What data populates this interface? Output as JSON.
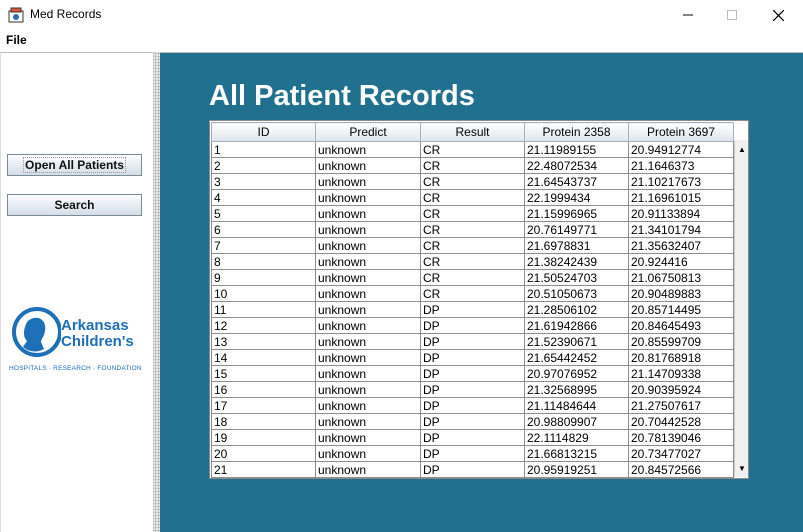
{
  "window": {
    "title": "Med Records",
    "controls": {
      "minimize": "—",
      "maximize": "☐",
      "close": "✕"
    }
  },
  "menu": {
    "file": "File"
  },
  "sidebar": {
    "open_all_label": "Open All Patients",
    "search_label": "Search",
    "logo": {
      "line1": "Arkansas",
      "line2": "Children's",
      "tagline": "HOSPITALS · RESEARCH · FOUNDATION"
    }
  },
  "main": {
    "title": "All Patient Records",
    "table": {
      "columns": [
        "ID",
        "Predict",
        "Result",
        "Protein 2358",
        "Protein 3697"
      ],
      "rows": [
        [
          "1",
          "unknown",
          "CR",
          "21.11989155",
          "20.94912774"
        ],
        [
          "2",
          "unknown",
          "CR",
          "22.48072534",
          "21.1646373"
        ],
        [
          "3",
          "unknown",
          "CR",
          "21.64543737",
          "21.10217673"
        ],
        [
          "4",
          "unknown",
          "CR",
          "22.1999434",
          "21.16961015"
        ],
        [
          "5",
          "unknown",
          "CR",
          "21.15996965",
          "20.91133894"
        ],
        [
          "6",
          "unknown",
          "CR",
          "20.76149771",
          "21.34101794"
        ],
        [
          "7",
          "unknown",
          "CR",
          "21.6978831",
          "21.35632407"
        ],
        [
          "8",
          "unknown",
          "CR",
          "21.38242439",
          "20.924416"
        ],
        [
          "9",
          "unknown",
          "CR",
          "21.50524703",
          "21.06750813"
        ],
        [
          "10",
          "unknown",
          "CR",
          "20.51050673",
          "20.90489883"
        ],
        [
          "11",
          "unknown",
          "DP",
          "21.28506102",
          "20.85714495"
        ],
        [
          "12",
          "unknown",
          "DP",
          "21.61942866",
          "20.84645493"
        ],
        [
          "13",
          "unknown",
          "DP",
          "21.52390671",
          "20.85599709"
        ],
        [
          "14",
          "unknown",
          "DP",
          "21.65442452",
          "20.81768918"
        ],
        [
          "15",
          "unknown",
          "DP",
          "20.97076952",
          "21.14709338"
        ],
        [
          "16",
          "unknown",
          "DP",
          "21.32568995",
          "20.90395924"
        ],
        [
          "17",
          "unknown",
          "DP",
          "21.11484644",
          "21.27507617"
        ],
        [
          "18",
          "unknown",
          "DP",
          "20.98809907",
          "20.70442528"
        ],
        [
          "19",
          "unknown",
          "DP",
          "22.1114829",
          "20.78139046"
        ],
        [
          "20",
          "unknown",
          "DP",
          "21.66813215",
          "20.73477027"
        ],
        [
          "21",
          "unknown",
          "DP",
          "20.95919251",
          "20.84572566"
        ]
      ]
    },
    "scrollbar": {
      "up": "▲",
      "down": "▼"
    }
  },
  "colors": {
    "main_background": "#22708f",
    "logo_blue": "#1d6fb8"
  }
}
